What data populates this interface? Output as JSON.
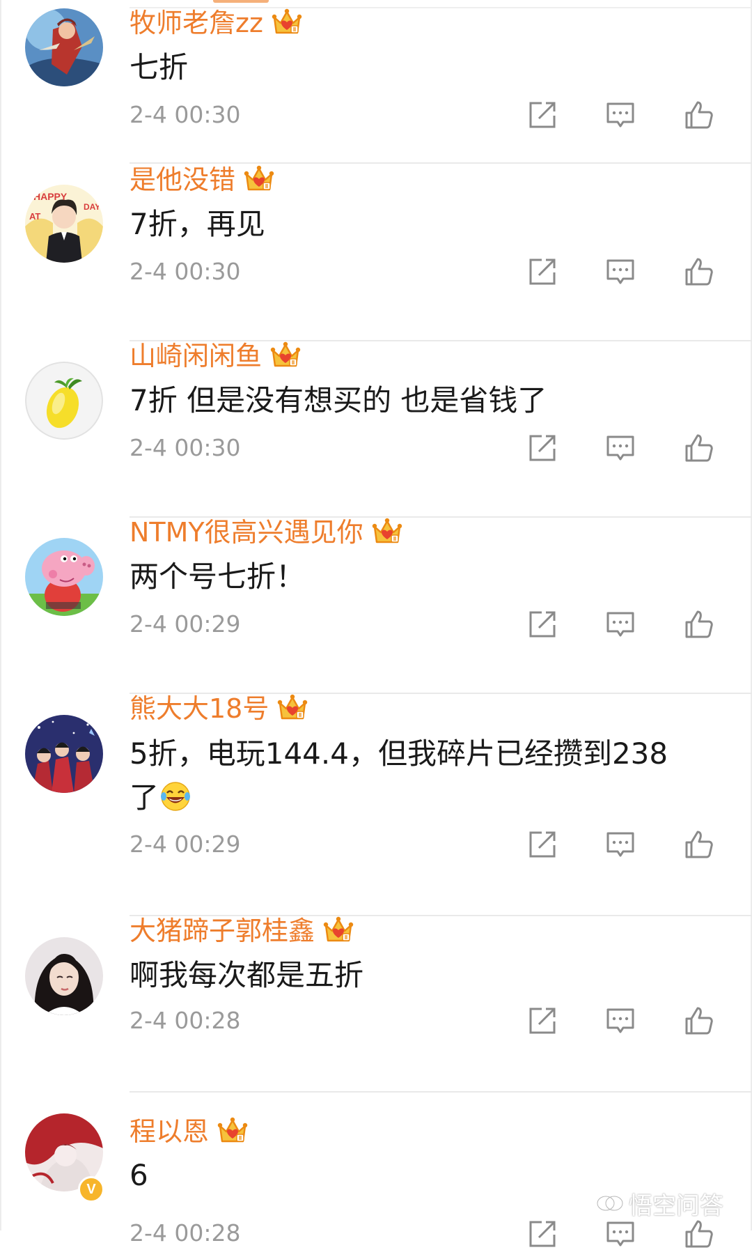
{
  "comments": [
    {
      "username": "牧师老詹zz",
      "text": "七折",
      "time": "2-4 00:30",
      "avatar": "avatar-game-hero"
    },
    {
      "username": "是他没错",
      "text": "7折，再见",
      "time": "2-4 00:30",
      "avatar": "avatar-happy-birthday"
    },
    {
      "username": "山崎闲闲鱼",
      "text": "7折 但是没有想买的 也是省钱了",
      "time": "2-4 00:30",
      "avatar": "avatar-mango"
    },
    {
      "username": "NTMY很高兴遇见你",
      "text": "两个号七折！",
      "time": "2-4 00:29",
      "avatar": "avatar-peppa-pig"
    },
    {
      "username": "熊大大18号",
      "text_line1": "5折，电玩144.4，但我碎片已经攒到238",
      "text_line2": "了",
      "emoji": "laughing-tears-emoji",
      "time": "2-4 00:29",
      "avatar": "avatar-group-photo"
    },
    {
      "username": "大猪蹄子郭桂鑫",
      "text": "啊我每次都是五折",
      "time": "2-4 00:28",
      "avatar": "avatar-girl-portrait"
    },
    {
      "username": "程以恩",
      "text": "6",
      "time": "2-4 00:28",
      "avatar": "avatar-red-illustration",
      "verified_badge": "V"
    }
  ],
  "icons": {
    "vip_badge": "crown-badge-icon",
    "share": "share-icon",
    "reply": "comment-icon",
    "like": "thumbs-up-icon"
  },
  "colors": {
    "username": "#ee7d2c",
    "text": "#1a1a1a",
    "time": "#9a9a9a",
    "icon": "#8a8a8a",
    "crown": "#f0a11e"
  },
  "watermark": {
    "text": "悟空问答"
  }
}
